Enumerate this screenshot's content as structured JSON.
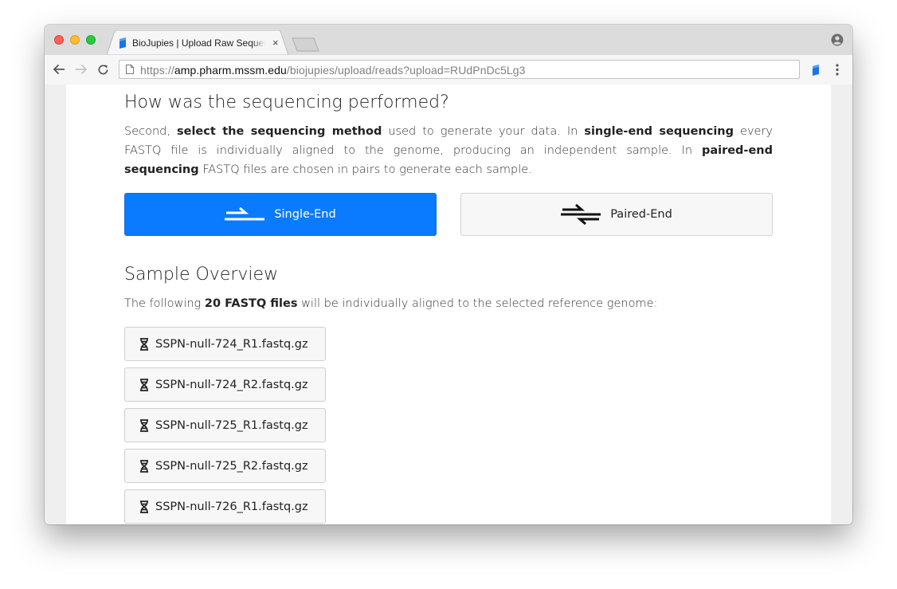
{
  "browser": {
    "tab_title": "BioJupies | Upload Raw Sequencing Data",
    "url_scheme": "https://",
    "url_host": "amp.pharm.mssm.edu",
    "url_path": "/biojupies/upload/reads?upload=RUdPnDc5Lg3",
    "close_glyph": "×"
  },
  "sequencing": {
    "heading": "How was the sequencing performed?",
    "desc": [
      {
        "t": "Second, ",
        "b": false
      },
      {
        "t": "select the sequencing method",
        "b": true
      },
      {
        "t": " used to generate your data. In ",
        "b": false
      },
      {
        "t": "single-end sequencing",
        "b": true
      },
      {
        "t": " every FASTQ file is individually aligned to the genome, producing an independent sample. In ",
        "b": false
      },
      {
        "t": "paired-end sequencing",
        "b": true
      },
      {
        "t": " FASTQ files are chosen in pairs to generate each sample.",
        "b": false
      }
    ],
    "single_label": "Single-End",
    "paired_label": "Paired-End"
  },
  "overview": {
    "heading": "Sample Overview",
    "desc": [
      {
        "t": "The following ",
        "b": false
      },
      {
        "t": "20 FASTQ files",
        "b": true
      },
      {
        "t": " will be individually aligned to the selected reference genome:",
        "b": false
      }
    ],
    "files": [
      "SSPN-null-724_R1.fastq.gz",
      "SSPN-null-724_R2.fastq.gz",
      "SSPN-null-725_R1.fastq.gz",
      "SSPN-null-725_R2.fastq.gz",
      "SSPN-null-726_R1.fastq.gz"
    ]
  },
  "colors": {
    "accent": "#0a7bff",
    "tab_strip": "#dcdcdc",
    "toolbar": "#f6f6f6"
  },
  "icons": {
    "favicon": "biojupies-favicon-icon",
    "single_end": "single-end-arrow-icon",
    "paired_end": "paired-end-arrows-icon",
    "file": "dna-icon"
  }
}
